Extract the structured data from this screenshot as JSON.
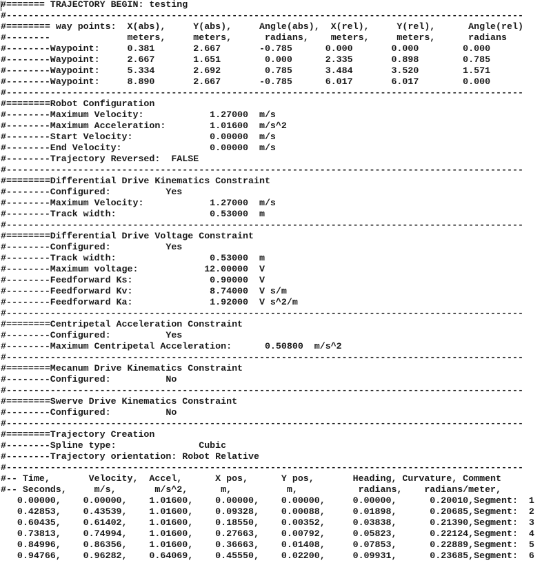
{
  "header": {
    "begin_line": "#======= TRAJECTORY BEGIN: testing"
  },
  "separator": "#----------------------------------------------------------------------------------------------",
  "waypoints": {
    "title_line": "#======== way points:  X(abs),     Y(abs),     Angle(abs),  X(rel),     Y(rel),      Angle(rel)",
    "units_line": "#--------              meters,     meters,      radians,    meters,     meters,      radians",
    "rows": [
      {
        "label": "#--------Waypoint:",
        "x_abs": "0.381",
        "y_abs": "2.667",
        "angle_abs": "-0.785",
        "x_rel": "0.000",
        "y_rel": "0.000",
        "angle_rel": "0.000"
      },
      {
        "label": "#--------Waypoint:",
        "x_abs": "2.667",
        "y_abs": "1.651",
        "angle_abs": "0.000",
        "x_rel": "2.335",
        "y_rel": "0.898",
        "angle_rel": "0.785"
      },
      {
        "label": "#--------Waypoint:",
        "x_abs": "5.334",
        "y_abs": "2.692",
        "angle_abs": "0.785",
        "x_rel": "3.484",
        "y_rel": "3.520",
        "angle_rel": "1.571"
      },
      {
        "label": "#--------Waypoint:",
        "x_abs": "8.890",
        "y_abs": "2.667",
        "angle_abs": "-0.785",
        "x_rel": "6.017",
        "y_rel": "6.017",
        "angle_rel": "0.000"
      }
    ]
  },
  "robot_configuration": {
    "title": "#========Robot Configuration",
    "lines": [
      "#--------Maximum Velocity:            1.27000  m/s",
      "#--------Maximum Acceleration:        1.01600  m/s^2",
      "#--------Start Velocity:              0.00000  m/s",
      "#--------End Velocity:                0.00000  m/s",
      "#--------Trajectory Reversed:  FALSE"
    ]
  },
  "diff_drive_kinematics": {
    "title": "#========Differential Drive Kinematics Constraint",
    "lines": [
      "#--------Configured:          Yes",
      "#--------Maximum Velocity:            1.27000  m/s",
      "#--------Track width:                 0.53000  m"
    ]
  },
  "diff_drive_voltage": {
    "title": "#========Differential Drive Voltage Constraint",
    "lines": [
      "#--------Configured:          Yes",
      "#--------Track width:                 0.53000  m",
      "#--------Maximum voltage:            12.00000  V",
      "#--------Feedforward Ks:              0.90000  V",
      "#--------Feedforward Kv:              8.74000  V s/m",
      "#--------Feedforward Ka:              1.92000  V s^2/m"
    ]
  },
  "centripetal": {
    "title": "#========Centripetal Acceleration Constraint",
    "lines": [
      "#--------Configured:          Yes",
      "#--------Maximum Centripetal Acceleration:      0.50800  m/s^2"
    ]
  },
  "mecanum": {
    "title": "#========Mecanum Drive Kinematics Constraint",
    "lines": [
      "#--------Configured:          No"
    ]
  },
  "swerve": {
    "title": "#========Swerve Drive Kinematics Constraint",
    "lines": [
      "#--------Configured:          No"
    ]
  },
  "trajectory_creation": {
    "title": "#========Trajectory Creation",
    "lines": [
      "#--------Spline type:               Cubic",
      "#--------Trajectory orientation: Robot Relative"
    ]
  },
  "samples": {
    "header_line": "#-- Time,       Velocity,  Accel,      X pos,      Y pos,       Heading, Curvature, Comment",
    "units_line": "#-- Seconds,     m/s,       m/s^2,      m,          m,           radians,    radians/meter,",
    "rows": [
      {
        "time": "0.00000",
        "velocity": "0.00000",
        "accel": "1.01600",
        "x": "0.00000",
        "y": "0.00000",
        "heading": "0.00000",
        "curvature": "0.20010",
        "comment": "Segment:",
        "segment": "1"
      },
      {
        "time": "0.42853",
        "velocity": "0.43539",
        "accel": "1.01600",
        "x": "0.09328",
        "y": "0.00088",
        "heading": "0.01898",
        "curvature": "0.20685",
        "comment": "Segment:",
        "segment": "2"
      },
      {
        "time": "0.60435",
        "velocity": "0.61402",
        "accel": "1.01600",
        "x": "0.18550",
        "y": "0.00352",
        "heading": "0.03838",
        "curvature": "0.21390",
        "comment": "Segment:",
        "segment": "3"
      },
      {
        "time": "0.73813",
        "velocity": "0.74994",
        "accel": "1.01600",
        "x": "0.27663",
        "y": "0.00792",
        "heading": "0.05823",
        "curvature": "0.22124",
        "comment": "Segment:",
        "segment": "4"
      },
      {
        "time": "0.84996",
        "velocity": "0.86356",
        "accel": "1.01600",
        "x": "0.36663",
        "y": "0.01408",
        "heading": "0.07853",
        "curvature": "0.22889",
        "comment": "Segment:",
        "segment": "5"
      },
      {
        "time": "0.94766",
        "velocity": "0.96282",
        "accel": "0.64069",
        "x": "0.45550",
        "y": "0.02200",
        "heading": "0.09931",
        "curvature": "0.23685",
        "comment": "Segment:",
        "segment": "6"
      }
    ]
  }
}
